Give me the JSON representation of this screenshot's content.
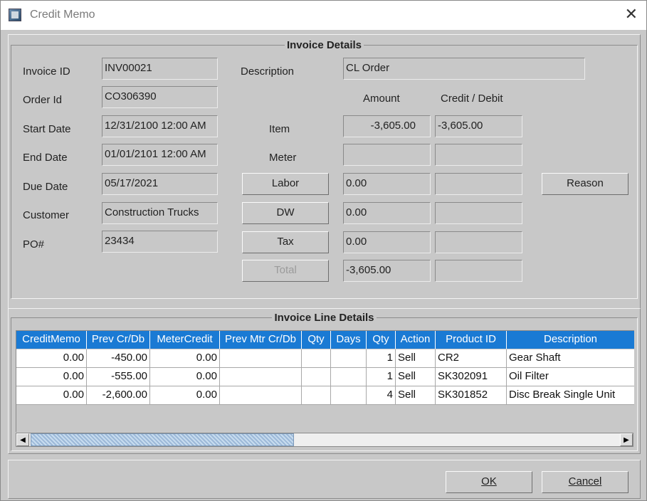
{
  "window": {
    "title": "Credit Memo",
    "icons": {
      "app": "app-icon",
      "close": "close-icon"
    },
    "close_glyph": "✕"
  },
  "invoice_details": {
    "title": "Invoice Details",
    "fields": {
      "invoice_id": {
        "label": "Invoice ID",
        "value": "INV00021"
      },
      "order_id": {
        "label": "Order Id",
        "value": "CO306390"
      },
      "start_date": {
        "label": "Start Date",
        "value": "12/31/2100 12:00 AM"
      },
      "end_date": {
        "label": "End  Date",
        "value": "01/01/2101 12:00 AM"
      },
      "due_date": {
        "label": "Due Date",
        "value": "05/17/2021"
      },
      "customer": {
        "label": "Customer",
        "value": "Construction Trucks"
      },
      "po": {
        "label": "PO#",
        "value": "23434"
      },
      "description": {
        "label": "Description",
        "value": "CL Order"
      }
    },
    "headers": {
      "amount": "Amount",
      "credit_debit": "Credit / Debit"
    },
    "lines": {
      "item": {
        "label": "Item",
        "amount": "-3,605.00",
        "credit": "-3,605.00"
      },
      "meter": {
        "label": "Meter",
        "amount": "",
        "credit": ""
      },
      "labor": {
        "label": "Labor",
        "amount": "0.00",
        "credit": ""
      },
      "dw": {
        "label": "DW",
        "amount": "0.00",
        "credit": ""
      },
      "tax": {
        "label": "Tax",
        "amount": "0.00",
        "credit": ""
      },
      "total": {
        "label": "Total",
        "amount": "-3,605.00",
        "credit": ""
      }
    },
    "reason_button": "Reason"
  },
  "line_details": {
    "title": "Invoice Line Details",
    "columns": [
      "CreditMemo",
      "Prev Cr/Db",
      "MeterCredit",
      "Prev Mtr Cr/Db",
      "Qty",
      "Days",
      "Qty",
      "Action",
      "Product ID",
      "Description"
    ],
    "rows": [
      [
        "0.00",
        "-450.00",
        "0.00",
        "",
        "",
        "",
        "1",
        "Sell",
        "CR2",
        "Gear Shaft"
      ],
      [
        "0.00",
        "-555.00",
        "0.00",
        "",
        "",
        "",
        "1",
        "Sell",
        "SK302091",
        "Oil Filter"
      ],
      [
        "0.00",
        "-2,600.00",
        "0.00",
        "",
        "",
        "",
        "4",
        "Sell",
        "SK301852",
        "Disc Break Single Unit"
      ]
    ],
    "scroll": {
      "left_glyph": "◀",
      "right_glyph": "▶"
    }
  },
  "footer": {
    "ok": "OK",
    "cancel": "Cancel"
  },
  "colors": {
    "header_blue": "#1a7ad4",
    "background": "#c8c8c8"
  }
}
